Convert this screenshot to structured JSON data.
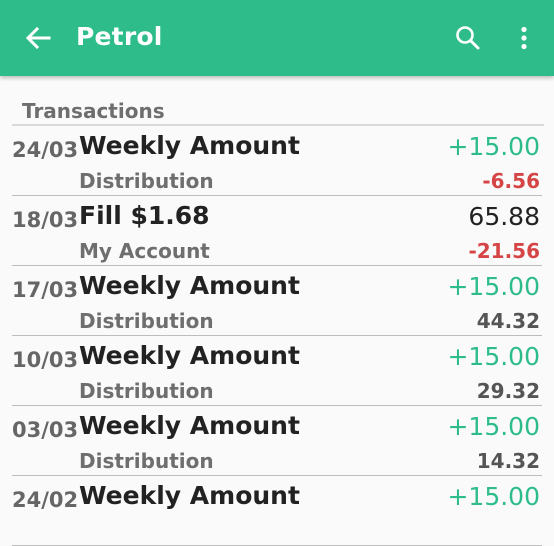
{
  "appbar": {
    "title": "Petrol",
    "back_icon": "arrow-left-icon",
    "search_icon": "search-icon",
    "more_icon": "more-vert-icon",
    "color": "#2ebd8a"
  },
  "section": {
    "title": "Transactions"
  },
  "transactions": [
    {
      "date": "24/03",
      "description": "Weekly Amount",
      "amount": "+15.00",
      "amount_positive": true,
      "account": "Distribution",
      "balance": "-6.56",
      "balance_negative": true
    },
    {
      "date": "18/03",
      "description": "Fill $1.68",
      "amount": "65.88",
      "amount_positive": false,
      "account": "My Account",
      "balance": "-21.56",
      "balance_negative": true
    },
    {
      "date": "17/03",
      "description": "Weekly Amount",
      "amount": "+15.00",
      "amount_positive": true,
      "account": "Distribution",
      "balance": "44.32",
      "balance_negative": false
    },
    {
      "date": "10/03",
      "description": "Weekly Amount",
      "amount": "+15.00",
      "amount_positive": true,
      "account": "Distribution",
      "balance": "29.32",
      "balance_negative": false
    },
    {
      "date": "03/03",
      "description": "Weekly Amount",
      "amount": "+15.00",
      "amount_positive": true,
      "account": "Distribution",
      "balance": "14.32",
      "balance_negative": false
    },
    {
      "date": "24/02",
      "description": "Weekly Amount",
      "amount": "+15.00",
      "amount_positive": true,
      "account": "",
      "balance": "",
      "balance_negative": false
    }
  ],
  "colors": {
    "positive": "#2ebd8a",
    "negative": "#d64545"
  }
}
